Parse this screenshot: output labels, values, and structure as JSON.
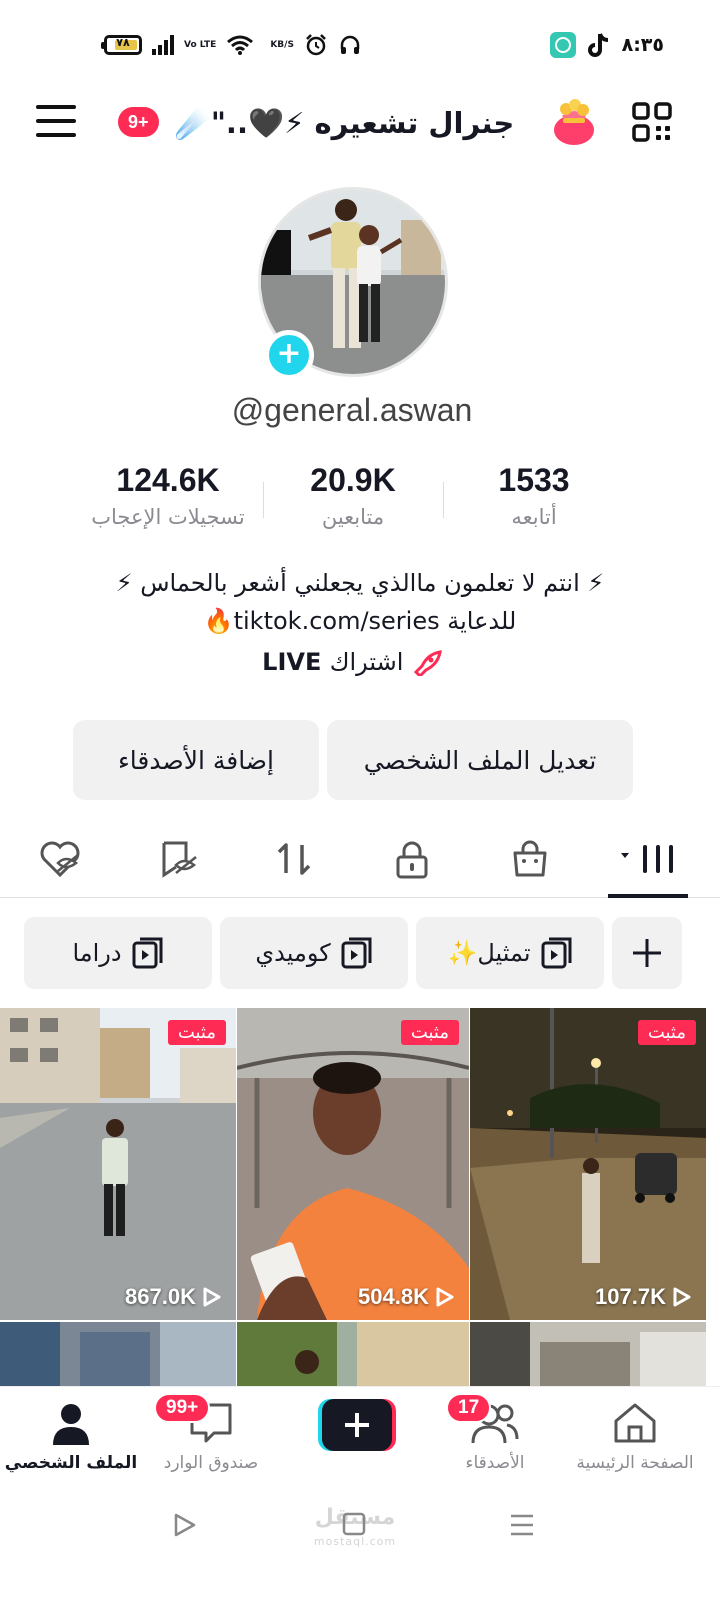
{
  "status_bar": {
    "time": "٨:٣٥",
    "battery": "٧٨",
    "volte": "Vo LTE",
    "speed_unit": "KB/S",
    "icons": [
      "battery-icon",
      "signal-icon",
      "volte-icon",
      "wifi-icon",
      "alarm-icon",
      "headset-icon",
      "app-notification-icon",
      "tiktok-icon"
    ]
  },
  "header": {
    "notification_badge": "9+",
    "display_name": "جنرال تشعيره ⚡🖤..\"☄️"
  },
  "profile": {
    "username": "@general.aswan",
    "stats": {
      "likes": {
        "value": "124.6K",
        "label": "تسجيلات الإعجاب"
      },
      "followers": {
        "value": "20.9K",
        "label": "متابعين"
      },
      "following": {
        "value": "1533",
        "label": "أتابعه"
      }
    },
    "bio_line1": "⚡ انتم لا تعلمون ماالذي يجعلني أشعر بالحماس ⚡",
    "bio_line2": "للدعاية tiktok.com/series🔥",
    "live_bold": "LIVE",
    "live_label": " اشتراك"
  },
  "buttons": {
    "edit_profile": "تعديل الملف الشخصي",
    "add_friends": "إضافة الأصدقاء"
  },
  "playlists": [
    {
      "label": "تمثيل✨"
    },
    {
      "label": "كوميدي"
    },
    {
      "label": "دراما"
    }
  ],
  "videos": [
    {
      "pinned": "مثبت",
      "views": "867.0K"
    },
    {
      "pinned": "مثبت",
      "views": "504.8K"
    },
    {
      "pinned": "مثبت",
      "views": "107.7K"
    }
  ],
  "bottom_nav": {
    "home": "الصفحة الرئيسية",
    "friends": "الأصدقاء",
    "friends_badge": "17",
    "inbox": "صندوق الوارد",
    "inbox_badge": "99+",
    "profile": "الملف الشخصي"
  },
  "watermark": {
    "line1": "مستقل",
    "line2": "mostaql.com"
  },
  "colors": {
    "accent": "#fe2c55",
    "cyan": "#20d5ec",
    "text": "#161823",
    "secondary_text": "#8a8b91",
    "button_bg": "#f1f1f2"
  }
}
